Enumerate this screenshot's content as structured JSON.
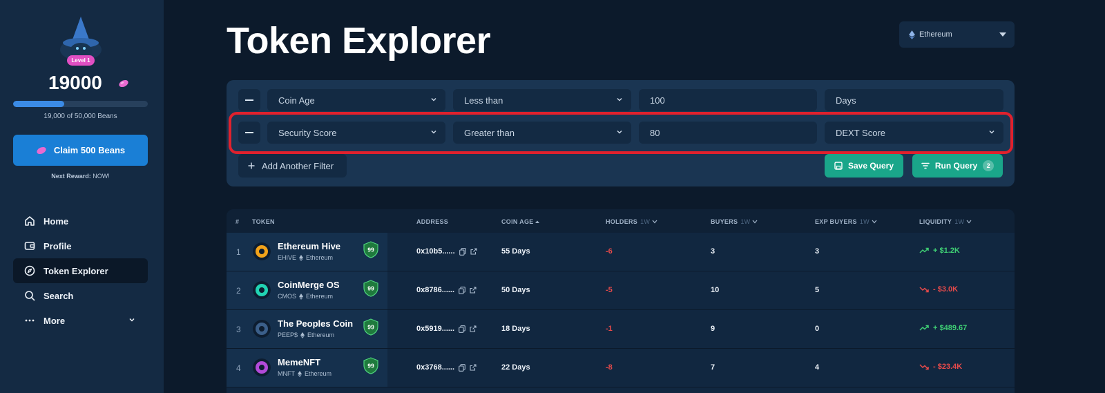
{
  "sidebar": {
    "level_badge": "Level 1",
    "bean_count": "19000",
    "progress_fraction": 0.38,
    "progress_text": "19,000 of 50,000 Beans",
    "claim_label": "Claim 500 Beans",
    "next_reward_label": "Next Reward:",
    "next_reward_value": "NOW!",
    "nav": [
      {
        "label": "Home",
        "icon": "home-icon"
      },
      {
        "label": "Profile",
        "icon": "wallet-icon"
      },
      {
        "label": "Token Explorer",
        "icon": "compass-icon",
        "active": true
      },
      {
        "label": "Search",
        "icon": "search-icon"
      },
      {
        "label": "More",
        "icon": "dots-icon"
      }
    ]
  },
  "header": {
    "title": "Token Explorer",
    "chain": "Ethereum"
  },
  "filters": {
    "rows": [
      {
        "field": "Coin Age",
        "operator": "Less than",
        "value": "100",
        "unit": "Days"
      },
      {
        "field": "Security Score",
        "operator": "Greater than",
        "value": "80",
        "unit": "DEXT Score"
      }
    ],
    "add_label": "Add Another Filter",
    "save_label": "Save Query",
    "run_label": "Run Query",
    "run_count": "2"
  },
  "table": {
    "columns": {
      "rank": "#",
      "token": "TOKEN",
      "address": "ADDRESS",
      "coin_age": "COIN AGE",
      "holders": "HOLDERS",
      "holders_sub": "1W",
      "buyers": "BUYERS",
      "buyers_sub": "1W",
      "exp_buyers": "EXP BUYERS",
      "exp_buyers_sub": "1W",
      "liquidity": "LIQUIDITY",
      "liquidity_sub": "1W"
    },
    "rows": [
      {
        "rank": "1",
        "name": "Ethereum Hive",
        "symbol": "EHIVE",
        "chain": "Ethereum",
        "score": "99",
        "address": "0x10b5......",
        "age": "55 Days",
        "holders": "-6",
        "buyers": "3",
        "exp_buyers": "3",
        "liquidity": "+ $1.2K",
        "trend": "up",
        "logo_color": "#f2a31a"
      },
      {
        "rank": "2",
        "name": "CoinMerge OS",
        "symbol": "CMOS",
        "chain": "Ethereum",
        "score": "99",
        "address": "0x8786......",
        "age": "50 Days",
        "holders": "-5",
        "buyers": "10",
        "exp_buyers": "5",
        "liquidity": "- $3.0K",
        "trend": "down",
        "logo_color": "#21d3b3"
      },
      {
        "rank": "3",
        "name": "The Peoples Coin",
        "symbol": "PEEP$",
        "chain": "Ethereum",
        "score": "99",
        "address": "0x5919......",
        "age": "18 Days",
        "holders": "-1",
        "buyers": "9",
        "exp_buyers": "0",
        "liquidity": "+ $489.67",
        "trend": "up",
        "logo_color": "#3b5f8a"
      },
      {
        "rank": "4",
        "name": "MemeNFT",
        "symbol": "MNFT",
        "chain": "Ethereum",
        "score": "99",
        "address": "0x3768......",
        "age": "22 Days",
        "holders": "-8",
        "buyers": "7",
        "exp_buyers": "4",
        "liquidity": "- $23.4K",
        "trend": "down",
        "logo_color": "#b24ad9"
      }
    ]
  }
}
